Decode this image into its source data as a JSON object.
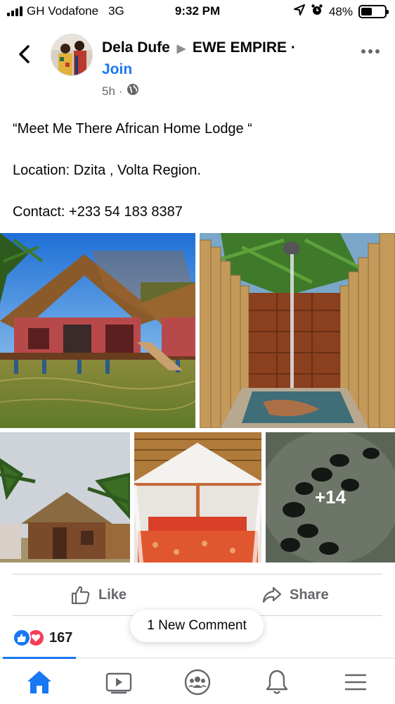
{
  "status_bar": {
    "carrier": "GH Vodafone",
    "network": "3G",
    "time": "9:32 PM",
    "battery": "48%",
    "battery_level": 0.48
  },
  "post": {
    "author": "Dela Dufe",
    "group": "EWE  EMPIRE",
    "separator": "·",
    "join_label": "Join",
    "time_ago": "5h",
    "meta_separator": "·",
    "audience_icon": "globe-icon",
    "text_lines": [
      "“Meet Me There African Home Lodge “",
      "Location: Dzita , Volta Region.",
      "Contact: +233 54 183 8387"
    ],
    "photos": [
      {
        "name": "lodge-on-water-photo"
      },
      {
        "name": "outdoor-shower-photo"
      },
      {
        "name": "thatched-hut-photo"
      },
      {
        "name": "bedroom-photo"
      },
      {
        "name": "baby-turtles-photo",
        "more_label": "+14"
      }
    ]
  },
  "actions": {
    "like_label": "Like",
    "share_label": "Share"
  },
  "reactions": {
    "count": "167",
    "icons": [
      "like-reaction-icon",
      "love-reaction-icon"
    ]
  },
  "new_comment_label": "1 New Comment",
  "bottom_nav": {
    "items": [
      "home-icon",
      "video-icon",
      "groups-icon",
      "notifications-icon",
      "menu-icon"
    ],
    "active": "home-icon"
  },
  "colors": {
    "accent": "#1877f2",
    "love": "#f33e58",
    "secondary_text": "#65676b"
  }
}
